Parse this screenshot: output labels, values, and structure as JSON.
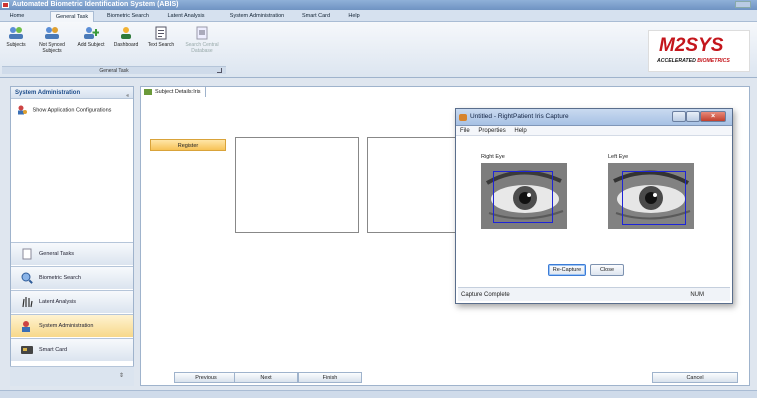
{
  "app": {
    "title": "Automated Biometric Identification System (ABIS)"
  },
  "menu_tabs": [
    "Home",
    "General Task",
    "Biometric Search",
    "Latent Analysis",
    "System Administration",
    "Smart Card",
    "Help"
  ],
  "ribbon": {
    "buttons": [
      {
        "label": "Subjects",
        "icon": "people-icon"
      },
      {
        "label": "Not Synced Subjects",
        "icon": "people-sync-icon"
      },
      {
        "label": "Add Subject",
        "icon": "add-person-icon"
      },
      {
        "label": "Dashboard",
        "icon": "dashboard-icon"
      },
      {
        "label": "Text Search",
        "icon": "text-search-icon"
      },
      {
        "label": "Search Central Database",
        "icon": "database-search-icon"
      }
    ],
    "group_label": "General Task"
  },
  "logo": {
    "brand": "M2SYS",
    "tag_prefix": "ACCELERATED ",
    "tag_suffix": "BIOMETRICS"
  },
  "sidebar": {
    "header": "System Administration",
    "items": [
      {
        "label": "Show Application Configurations"
      }
    ],
    "nav": [
      {
        "label": "General Tasks",
        "icon": "document-icon"
      },
      {
        "label": "Biometric Search",
        "icon": "magnifier-icon"
      },
      {
        "label": "Latent Analysis",
        "icon": "fingerprint-icon"
      },
      {
        "label": "System Administration",
        "icon": "admin-icon"
      },
      {
        "label": "Smart Card",
        "icon": "smart-card-icon"
      }
    ]
  },
  "document_tab": {
    "label": "Subject Details:Iris"
  },
  "main": {
    "register_label": "Register",
    "previous_label": "Previous",
    "next_label": "Next",
    "finish_label": "Finish",
    "cancel_label": "Cancel"
  },
  "dialog": {
    "title": "Untitled - RightPatient Iris Capture",
    "menu": [
      "File",
      "Properties",
      "Help"
    ],
    "right_eye_label": "Right Eye",
    "left_eye_label": "Left Eye",
    "recapture_label": "Re-Capture",
    "close_label": "Close",
    "status": "Capture Complete",
    "num_indicator": "NUM"
  },
  "colors": {
    "accent_orange": "#f7c257",
    "brand_red": "#c4161c",
    "capture_box_blue": "#1d24d8"
  }
}
